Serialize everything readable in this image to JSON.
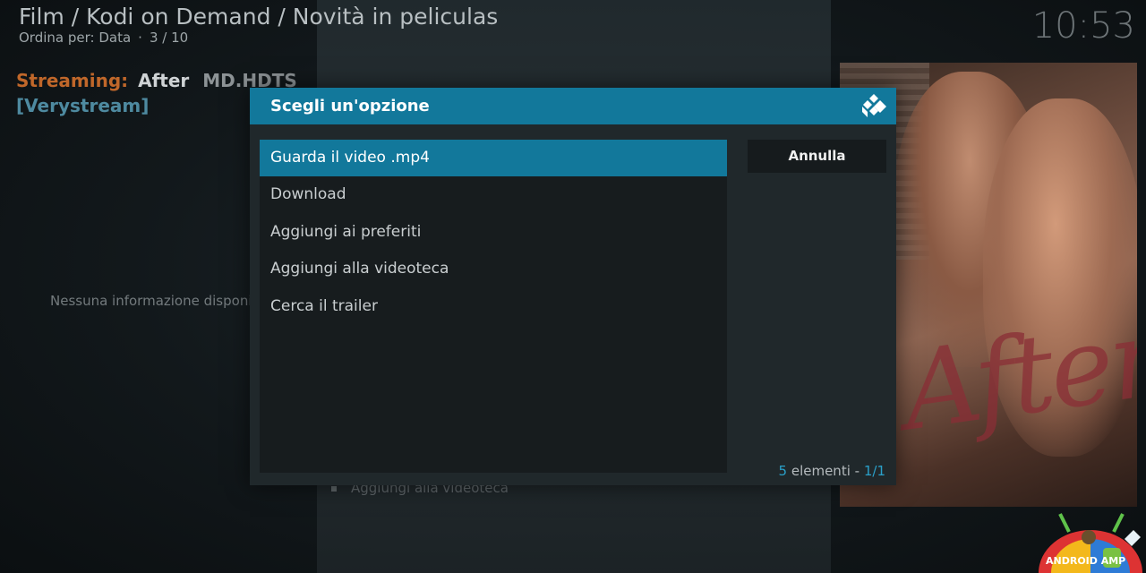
{
  "header": {
    "breadcrumb": "Film / Kodi on Demand / Novità in peliculas",
    "sort_label": "Ordina per: Data",
    "position": "3 / 10",
    "clock": "10:53"
  },
  "info": {
    "streaming_label": "Streaming:",
    "title": "After",
    "quality": "MD.HDTS",
    "host": "[Verystream]",
    "no_info": "Nessuna informazione disponibile",
    "background_item": "Aggiungi alla videoteca"
  },
  "poster": {
    "title_text": "After"
  },
  "dialog": {
    "title": "Scegli un'opzione",
    "options": [
      {
        "label": "Guarda il video .mp4",
        "selected": true
      },
      {
        "label": "Download",
        "selected": false
      },
      {
        "label": "Aggiungi ai preferiti",
        "selected": false
      },
      {
        "label": "Aggiungi alla videoteca",
        "selected": false
      },
      {
        "label": "Cerca il trailer",
        "selected": false
      }
    ],
    "cancel_label": "Annulla",
    "count_number": "5",
    "count_text": "elementi",
    "count_dash": "-",
    "page": "1/1"
  },
  "watermark": {
    "text": "ANDROID AMP"
  },
  "colors": {
    "accent": "#12789b",
    "streaming_label": "#c0672a",
    "host": "#4e8aa0",
    "dialog_bg": "#20282b"
  },
  "icons": [
    "kodi-logo-icon"
  ]
}
